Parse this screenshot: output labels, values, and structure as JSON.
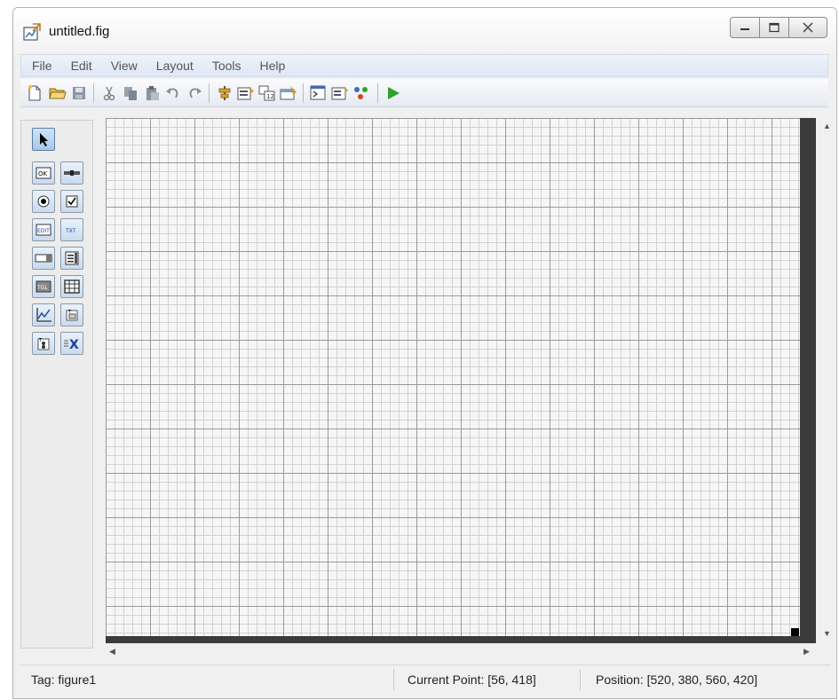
{
  "window": {
    "title": "untitled.fig"
  },
  "menu": [
    "File",
    "Edit",
    "View",
    "Layout",
    "Tools",
    "Help"
  ],
  "toolbar": {
    "icons": [
      "new-file-icon",
      "open-folder-icon",
      "save-icon",
      "cut-icon",
      "copy-icon",
      "paste-icon",
      "undo-icon",
      "redo-icon",
      "align-objects-icon",
      "menu-editor-icon",
      "tab-order-editor-icon",
      "toolbar-editor-icon",
      "editor-icon",
      "property-inspector-icon",
      "object-browser-icon",
      "run-icon"
    ]
  },
  "palette": {
    "tools": [
      {
        "name": "select-tool",
        "glyph": "arrow"
      },
      {
        "name": "push-button-tool",
        "glyph": "OK"
      },
      {
        "name": "slider-tool",
        "glyph": "slider"
      },
      {
        "name": "radio-button-tool",
        "glyph": "radio"
      },
      {
        "name": "checkbox-tool",
        "glyph": "check"
      },
      {
        "name": "edit-text-tool",
        "glyph": "EDIT"
      },
      {
        "name": "static-text-tool",
        "glyph": "TXT"
      },
      {
        "name": "popup-menu-tool",
        "glyph": "popup"
      },
      {
        "name": "listbox-tool",
        "glyph": "list"
      },
      {
        "name": "toggle-button-tool",
        "glyph": "TGL"
      },
      {
        "name": "table-tool",
        "glyph": "table"
      },
      {
        "name": "axes-tool",
        "glyph": "axes"
      },
      {
        "name": "panel-tool",
        "glyph": "panel"
      },
      {
        "name": "button-group-tool",
        "glyph": "group"
      },
      {
        "name": "activex-control-tool",
        "glyph": "X"
      }
    ]
  },
  "status": {
    "tag": "Tag: figure1",
    "current_point": "Current Point:  [56, 418]",
    "position": "Position: [520, 380, 560, 420]"
  },
  "colors": {
    "run_green": "#2fa12f",
    "palette_blue": "#c9dbee",
    "canvas_edge": "#3b3b3b"
  }
}
